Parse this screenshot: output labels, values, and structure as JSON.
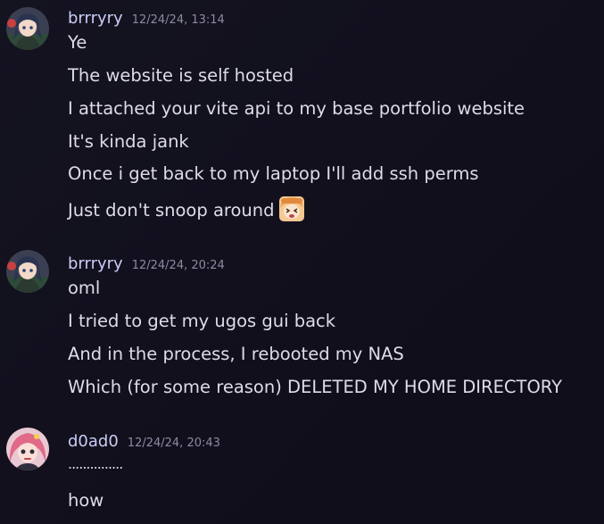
{
  "messages": [
    {
      "author": "brrryry",
      "timestamp": "12/24/24, 13:14",
      "avatar": "avatar-dark-hair-girl",
      "lines": [
        "Ye",
        "The website is self hosted",
        "I attached your vite api to my base portfolio website",
        "It's kinda jank",
        "Once i get back to my laptop I'll add ssh perms",
        "Just don't snoop around"
      ],
      "emoji": "umaru-emoji"
    },
    {
      "author": "brrryry",
      "timestamp": "12/24/24, 20:24",
      "avatar": "avatar-dark-hair-girl",
      "lines": [
        "oml",
        "I tried to get my ugos gui back",
        "And in the process, I rebooted my NAS",
        "Which (for some reason) DELETED MY HOME DIRECTORY"
      ]
    },
    {
      "author": "d0ad0",
      "timestamp": "12/24/24, 20:43",
      "avatar": "avatar-pink-hair-girl",
      "lines": [
        "...............",
        "how"
      ]
    }
  ],
  "colors": {
    "background": "#13121e",
    "username": "#c9cdf5",
    "timestamp": "#8c8aa0",
    "text": "#dedce8"
  }
}
